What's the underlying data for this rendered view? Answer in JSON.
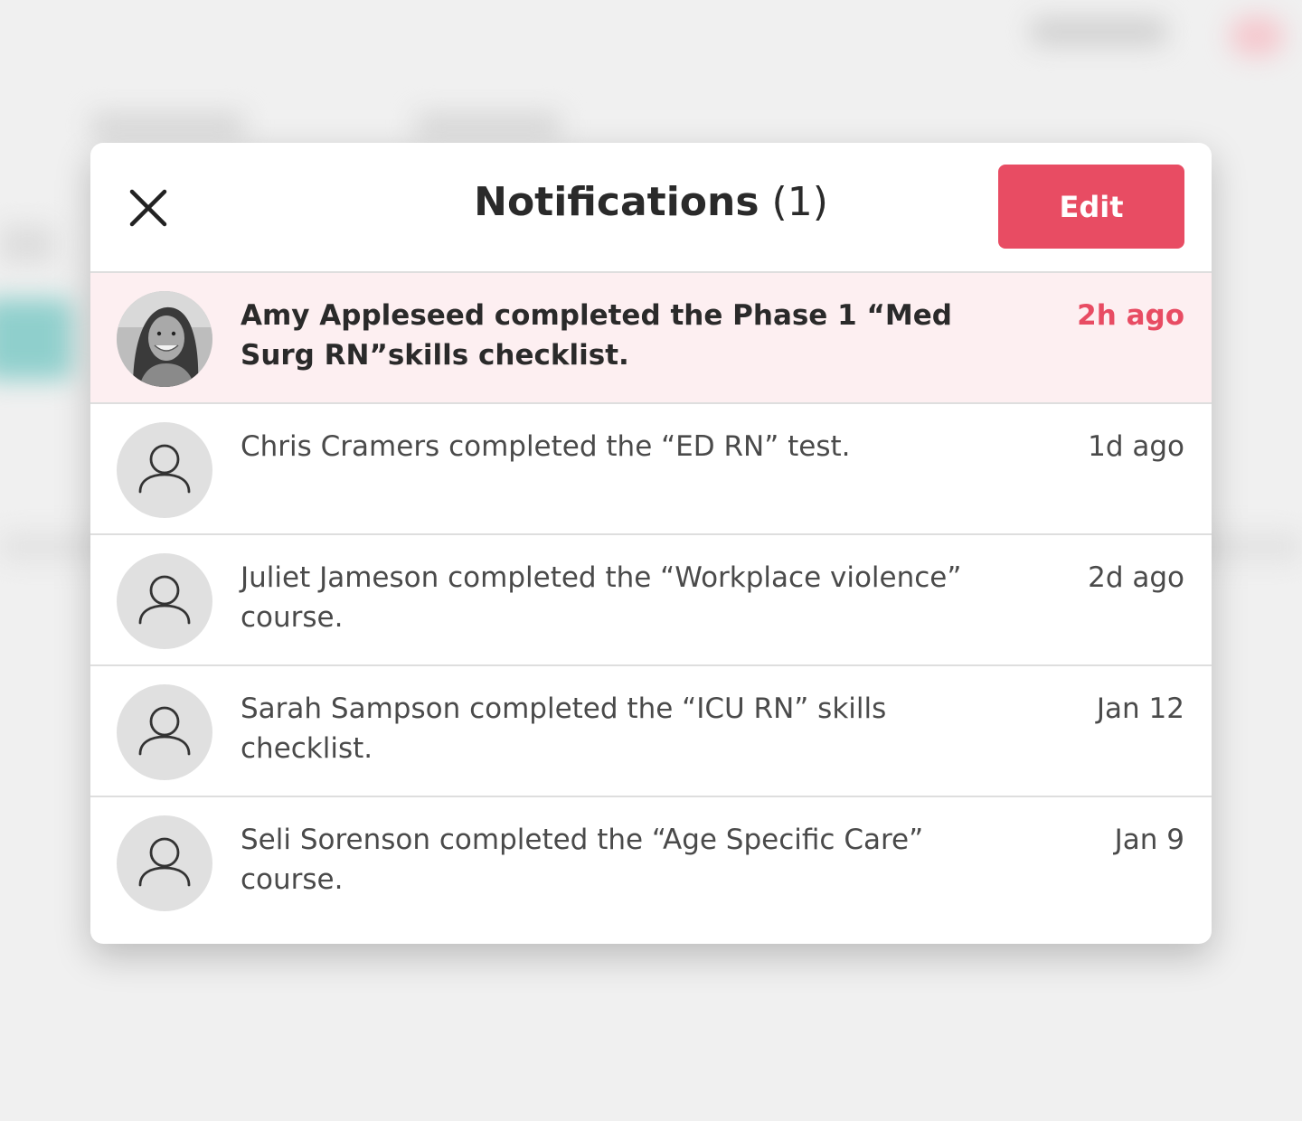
{
  "modal": {
    "title": "Notifications",
    "count": "(1)",
    "edit_label": "Edit"
  },
  "notifications": [
    {
      "message": "Amy Appleseed completed the Phase 1 “Med Surg RN”skills checklist.",
      "time": "2h ago",
      "unread": true,
      "avatar": "photo-avatar"
    },
    {
      "message": "Chris Cramers completed the “ED RN” test.",
      "time": "1d ago",
      "unread": false,
      "avatar": "user-icon"
    },
    {
      "message": "Juliet Jameson completed the “Workplace violence” course.",
      "time": "2d ago",
      "unread": false,
      "avatar": "user-icon"
    },
    {
      "message": "Sarah Sampson completed the “ICU RN” skills checklist.",
      "time": "Jan 12",
      "unread": false,
      "avatar": "user-icon"
    },
    {
      "message": "Seli Sorenson completed the “Age Specific Care” course.",
      "time": "Jan 9",
      "unread": false,
      "avatar": "user-icon"
    }
  ],
  "colors": {
    "accent": "#e84c63",
    "unread_bg": "#fdeff1"
  }
}
